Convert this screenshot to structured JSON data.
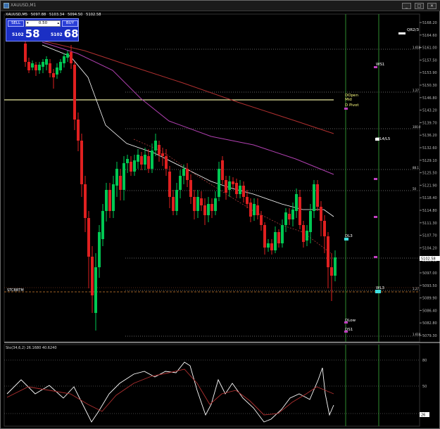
{
  "window": {
    "title": "XAUUSD,M1",
    "buttons": {
      "minimize": "_",
      "maximize": "□",
      "close": "✕"
    }
  },
  "ohlc": {
    "symbol": "XAUUSD,M5",
    "open": "5097.88",
    "high": "5103.34",
    "low": "5094.50",
    "close": "5102.58"
  },
  "trade_panel": {
    "sell_label": "SELL",
    "buy_label": "BUY",
    "lot_value": "0.50",
    "sell_price_small": "5102",
    "sell_price_big": "58",
    "buy_price_small": "5102",
    "buy_price_big": "68",
    "bg_color": "#1b2fc4"
  },
  "price_axis": {
    "ticks": [
      "5168.20",
      "5164.60",
      "5161.00",
      "5157.50",
      "5153.90",
      "5150.30",
      "5146.80",
      "5143.20",
      "5139.70",
      "5136.20",
      "5132.60",
      "5129.10",
      "5125.50",
      "5121.90",
      "5118.40",
      "5114.80",
      "5111.30",
      "5107.70",
      "5104.20",
      "5100.60",
      "5097.00",
      "5093.50",
      "5089.90",
      "5086.40",
      "5082.80",
      "5079.30"
    ],
    "current_price": "5102.58"
  },
  "levels": {
    "fib_labels": [
      "1.618",
      "1.27",
      "100.0",
      "88.1",
      "50",
      "1.27",
      "1.618"
    ],
    "pivot_labels": [
      "QR2/3",
      "WS1",
      "DOpen",
      "Mid",
      "D Pivot",
      "WL4/L5",
      "DL3",
      "DLow",
      "DS1",
      "WL3"
    ],
    "legend_text": "STCBBTM",
    "stoch_title": "Sto(34,6,2) 26.1680 40.6240",
    "stoch_ticks": [
      "80",
      "50",
      "20"
    ],
    "stoch_current": "26"
  },
  "colors": {
    "bull": "#00c853",
    "bear": "#e02020",
    "ma_white": "#ffffff",
    "ma_red": "#b03030",
    "ma_magenta": "#b040b0",
    "grid_dot": "#888888",
    "yellow_line": "#e8e8a0",
    "vline_green": "#2e8b2e"
  }
}
